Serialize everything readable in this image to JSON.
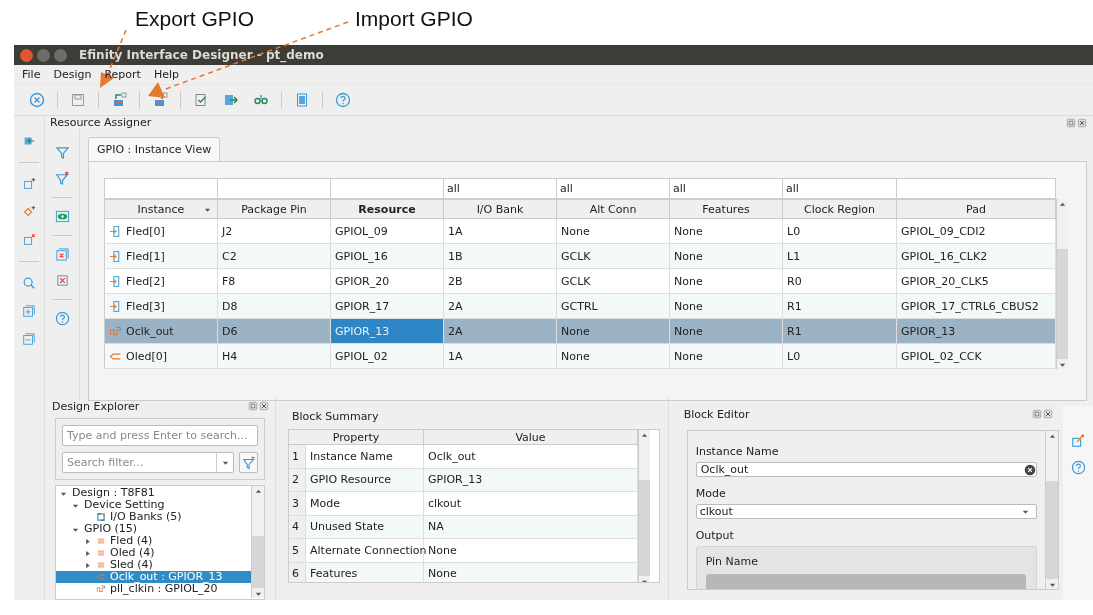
{
  "annotations": [
    {
      "label": "Export GPIO"
    },
    {
      "label": "Import GPIO"
    }
  ],
  "window": {
    "title": "Efinity Interface Designer - pt_demo"
  },
  "menu": [
    "File",
    "Design",
    "Report",
    "Help"
  ],
  "resource_assigner": {
    "title": "Resource Assigner",
    "tabs": [
      {
        "label": "GPIO : Instance View",
        "selected": true
      }
    ],
    "table": {
      "filters": [
        "all",
        "all",
        "all",
        "all"
      ],
      "columns": [
        {
          "label": "Instance",
          "sorted": true,
          "bold": false
        },
        {
          "label": "Package Pin",
          "sorted": false,
          "bold": false
        },
        {
          "label": "Resource",
          "sorted": false,
          "bold": true
        },
        {
          "label": "I/O Bank",
          "sorted": false,
          "bold": false
        },
        {
          "label": "Alt Conn",
          "sorted": false,
          "bold": false
        },
        {
          "label": "Features",
          "sorted": false,
          "bold": false
        },
        {
          "label": "Clock Region",
          "sorted": false,
          "bold": false
        },
        {
          "label": "Pad",
          "sorted": false,
          "bold": false
        }
      ],
      "rows": [
        {
          "kind": "input",
          "selected": false,
          "focused": false,
          "cells": [
            "Fled[0]",
            "J2",
            "GPIOL_09",
            "1A",
            "None",
            "None",
            "L0",
            "GPIOL_09_CDI2"
          ]
        },
        {
          "kind": "input",
          "selected": false,
          "focused": false,
          "cells": [
            "Fled[1]",
            "C2",
            "GPIOL_16",
            "1B",
            "GCLK",
            "None",
            "L1",
            "GPIOL_16_CLK2"
          ]
        },
        {
          "kind": "input",
          "selected": false,
          "focused": false,
          "cells": [
            "Fled[2]",
            "F8",
            "GPIOR_20",
            "2B",
            "GCLK",
            "None",
            "R0",
            "GPIOR_20_CLK5"
          ]
        },
        {
          "kind": "input",
          "selected": false,
          "focused": false,
          "cells": [
            "Fled[3]",
            "D8",
            "GPIOR_17",
            "2A",
            "GCTRL",
            "None",
            "R1",
            "GPIOR_17_CTRL6_CBUS2"
          ]
        },
        {
          "kind": "clock",
          "selected": true,
          "focused": true,
          "cells": [
            "Oclk_out",
            "D6",
            "GPIOR_13",
            "2A",
            "None",
            "None",
            "R1",
            "GPIOR_13"
          ]
        },
        {
          "kind": "output",
          "selected": false,
          "focused": false,
          "cells": [
            "Oled[0]",
            "H4",
            "GPIOL_02",
            "1A",
            "None",
            "None",
            "L0",
            "GPIOL_02_CCK"
          ]
        }
      ]
    }
  },
  "design_explorer": {
    "title": "Design Explorer",
    "search": {
      "placeholder": "Type and press Enter to search..."
    },
    "filter": {
      "placeholder": "Search filter..."
    },
    "tree": [
      {
        "label": "Design : T8F81",
        "expanded": true,
        "selected": false,
        "children": [
          {
            "label": "Device Setting",
            "expanded": true,
            "selected": false,
            "children": [
              {
                "label": "I/O Banks (5)",
                "kind": "bank",
                "selected": false
              }
            ]
          },
          {
            "label": "GPIO (15)",
            "expanded": true,
            "selected": false,
            "children": [
              {
                "label": "Fled (4)",
                "kind": "group",
                "expanded": false,
                "selected": false
              },
              {
                "label": "Oled (4)",
                "kind": "group",
                "expanded": false,
                "selected": false
              },
              {
                "label": "Sled (4)",
                "kind": "group",
                "expanded": false,
                "selected": false
              },
              {
                "label": "Oclk_out : GPIOR_13",
                "kind": "output",
                "selected": true
              },
              {
                "label": "pll_clkin : GPIOL_20",
                "kind": "clock",
                "selected": false
              }
            ]
          }
        ]
      }
    ]
  },
  "block_summary": {
    "title": "Block Summary",
    "columns": [
      "Property",
      "Value"
    ],
    "rows": [
      {
        "number": "1",
        "property": "Instance Name",
        "value": "Oclk_out"
      },
      {
        "number": "2",
        "property": "GPIO Resource",
        "value": "GPIOR_13"
      },
      {
        "number": "3",
        "property": "Mode",
        "value": "clkout"
      },
      {
        "number": "4",
        "property": "Unused State",
        "value": "NA"
      },
      {
        "number": "5",
        "property": "Alternate Connection",
        "value": "None"
      },
      {
        "number": "6",
        "property": "Features",
        "value": "None"
      }
    ]
  },
  "block_editor": {
    "title": "Block Editor",
    "fields": [
      {
        "kind": "text",
        "label": "Instance Name",
        "value": "Oclk_out"
      },
      {
        "kind": "select",
        "label": "Mode",
        "value": "clkout"
      },
      {
        "kind": "group",
        "label": "Output",
        "children": [
          {
            "kind": "disabled",
            "label": "Pin Name"
          }
        ]
      }
    ]
  }
}
